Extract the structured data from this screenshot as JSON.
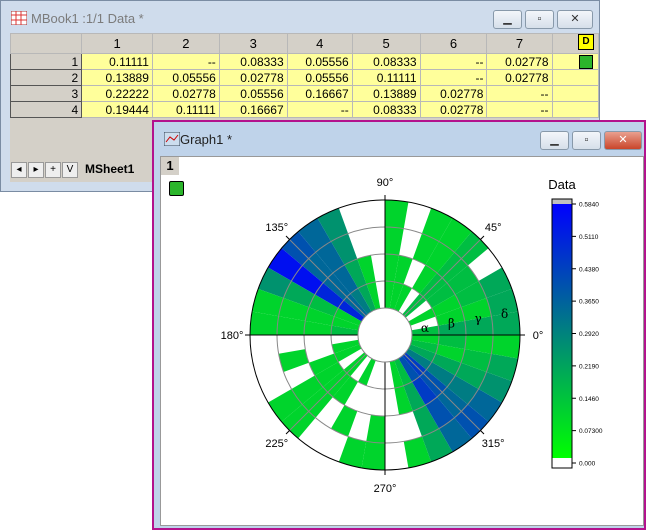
{
  "workbook": {
    "title": "MBook1 :1/1 Data *",
    "columns": [
      "1",
      "2",
      "3",
      "4",
      "5",
      "6",
      "7"
    ],
    "rows": [
      {
        "label": "1",
        "cells": [
          "0.11111",
          "--",
          "0.08333",
          "0.05556",
          "0.08333",
          "--",
          "0.02778"
        ]
      },
      {
        "label": "2",
        "cells": [
          "0.13889",
          "0.05556",
          "0.02778",
          "0.05556",
          "0.11111",
          "--",
          "0.02778"
        ]
      },
      {
        "label": "3",
        "cells": [
          "0.22222",
          "0.02778",
          "0.05556",
          "0.16667",
          "0.13889",
          "0.02778",
          "--"
        ]
      },
      {
        "label": "4",
        "cells": [
          "0.19444",
          "0.11111",
          "0.16667",
          "--",
          "0.08333",
          "0.02778",
          "--"
        ]
      }
    ],
    "sheet_tab": "MSheet1",
    "tab_nav": [
      "◂",
      "▸",
      "+",
      "V"
    ]
  },
  "graph": {
    "title": "Graph1 *",
    "layer_label": "1",
    "border_color": "#b3128d"
  },
  "chart_data": {
    "type": "heatmap",
    "subtype": "polar",
    "angle_labels": [
      "0°",
      "45°",
      "90°",
      "135°",
      "180°",
      "225°",
      "270°",
      "315°"
    ],
    "ring_labels": [
      "α",
      "β",
      "γ",
      "δ"
    ],
    "sector_step_deg": 10,
    "values": [
      [
        0.15,
        0.2,
        0.2,
        0.2
      ],
      [
        0,
        0.1,
        0.1,
        0.2
      ],
      [
        0.1,
        0.1,
        0.15,
        0.2
      ],
      [
        0,
        0.15,
        0.15,
        0
      ],
      [
        0.15,
        0.15,
        0.15,
        0.15
      ],
      [
        0,
        0.1,
        0.1,
        0.1
      ],
      [
        0.1,
        0,
        0.1,
        0.1
      ],
      [
        0.1,
        0.1,
        0,
        0
      ],
      [
        0.1,
        0.1,
        0.1,
        0.1
      ],
      [
        0,
        0,
        0,
        0
      ],
      [
        0.1,
        0.1,
        0,
        0
      ],
      [
        0.2,
        0.2,
        0.25,
        0.25
      ],
      [
        0.3,
        0.35,
        0.35,
        0.35
      ],
      [
        0.35,
        0.35,
        0.35,
        0.4
      ],
      [
        0.5,
        0.5,
        0.55,
        0.55
      ],
      [
        0.1,
        0.15,
        0.2,
        0.25
      ],
      [
        0.1,
        0.1,
        0.1,
        0.1
      ],
      [
        0.15,
        0.1,
        0.1,
        0.1
      ],
      [
        0,
        0,
        0,
        0
      ],
      [
        0.1,
        0,
        0.1,
        0
      ],
      [
        0.1,
        0.1,
        0,
        0
      ],
      [
        0,
        0.1,
        0.1,
        0.1
      ],
      [
        0.1,
        0.1,
        0.1,
        0.1
      ],
      [
        0,
        0.1,
        0,
        0
      ],
      [
        0.1,
        0,
        0.1,
        0
      ],
      [
        0,
        0,
        0,
        0.1
      ],
      [
        0,
        0,
        0.1,
        0.1
      ],
      [
        0,
        0,
        0,
        0
      ],
      [
        0.1,
        0.1,
        0,
        0.1
      ],
      [
        0.15,
        0.2,
        0.2,
        0.2
      ],
      [
        0.4,
        0.45,
        0.4,
        0.35
      ],
      [
        0.45,
        0.4,
        0.35,
        0.4
      ],
      [
        0.3,
        0.3,
        0.3,
        0.35
      ],
      [
        0.2,
        0.2,
        0.2,
        0.25
      ],
      [
        0.15,
        0.1,
        0.15,
        0.2
      ],
      [
        0.1,
        0.15,
        0.1,
        0.1
      ]
    ],
    "colorbar": {
      "title": "Data",
      "ticks": [
        "0.000",
        "0.07300",
        "0.1460",
        "0.2190",
        "0.2920",
        "0.3650",
        "0.4380",
        "0.5110",
        "0.5840"
      ],
      "range": [
        0,
        0.584
      ],
      "colors": {
        "low": "#00ff00",
        "mid": "#008080",
        "high": "#0000ff"
      }
    }
  }
}
